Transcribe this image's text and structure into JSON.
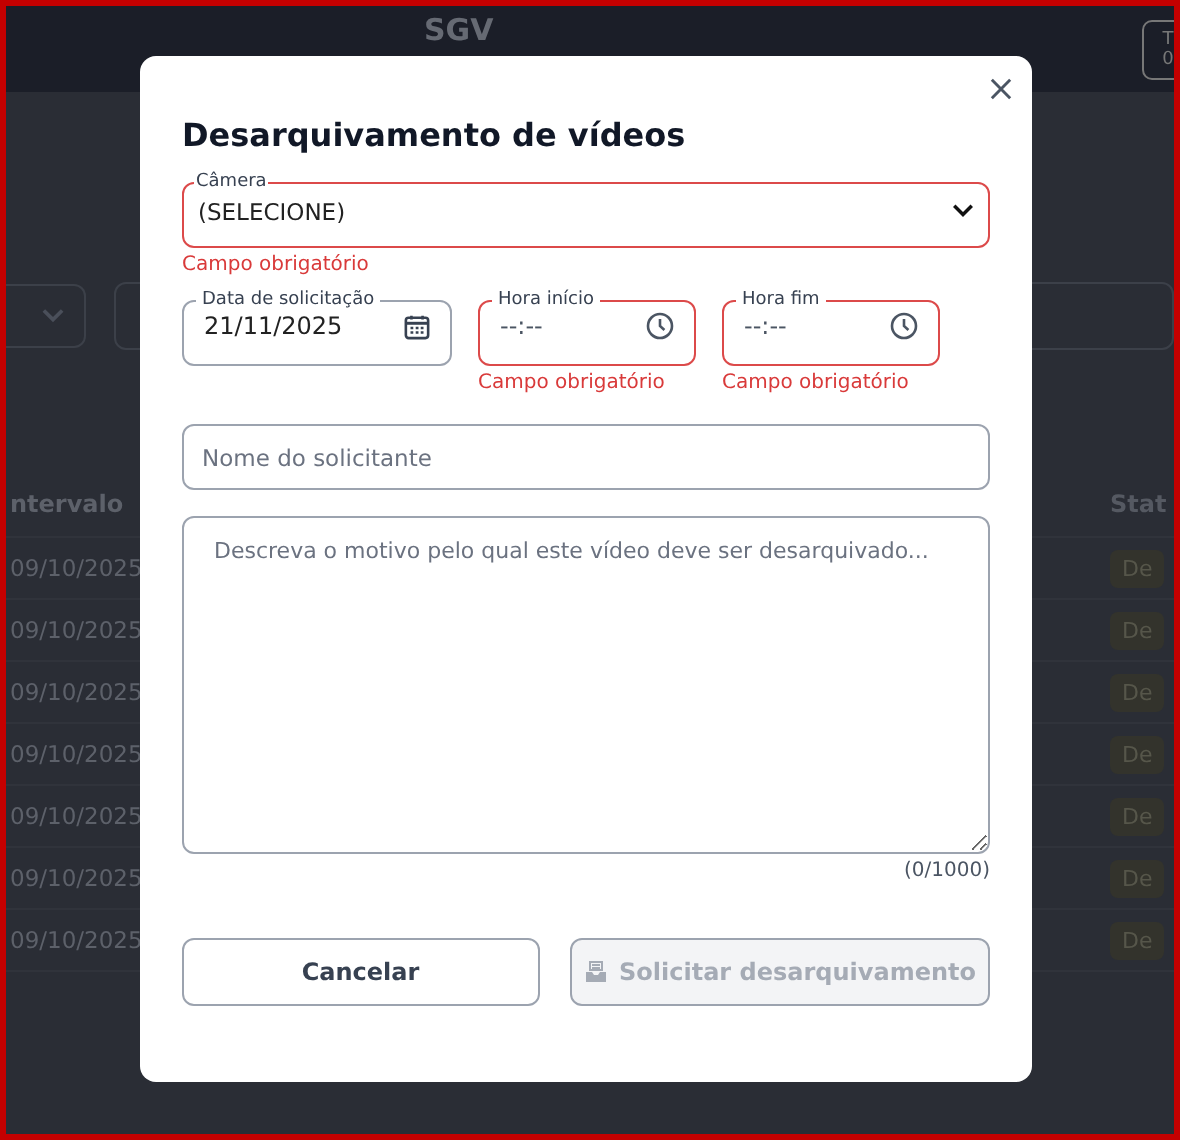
{
  "background": {
    "app_title": "SGV",
    "header_button": {
      "line_1": "T",
      "line_2": "0"
    },
    "table": {
      "columns": [
        "ntervalo",
        "Stat"
      ],
      "rows": [
        {
          "date": "09/10/2025",
          "status": "De"
        },
        {
          "date": "09/10/2025",
          "status": "De"
        },
        {
          "date": "09/10/2025",
          "status": "De"
        },
        {
          "date": "09/10/2025",
          "status": "De"
        },
        {
          "date": "09/10/2025",
          "status": "De"
        },
        {
          "date": "09/10/2025",
          "status": "De"
        },
        {
          "date": "09/10/2025",
          "status": "De"
        }
      ]
    }
  },
  "dialog": {
    "title": "Desarquivamento de vídeos",
    "camera": {
      "label": "Câmera",
      "value": "(SELECIONE)",
      "error": "Campo obrigatório"
    },
    "fields": [
      {
        "kind": "date",
        "label": "Data de solicitação",
        "value": "21/11/2025"
      },
      {
        "kind": "time",
        "label": "Hora início",
        "value": "--:--",
        "error": "Campo obrigatório"
      },
      {
        "kind": "time",
        "label": "Hora fim",
        "value": "--:--",
        "error": "Campo obrigatório"
      }
    ],
    "requester": {
      "placeholder": "Nome do solicitante"
    },
    "reason": {
      "placeholder": "Descreva o motivo pelo qual este vídeo deve ser desarquivado...",
      "counter": "(0/1000)"
    },
    "buttons": [
      {
        "kind": "cancel",
        "label": "Cancelar",
        "disabled": false
      },
      {
        "kind": "submit",
        "label": "Solicitar desarquivamento",
        "disabled": true
      }
    ]
  }
}
